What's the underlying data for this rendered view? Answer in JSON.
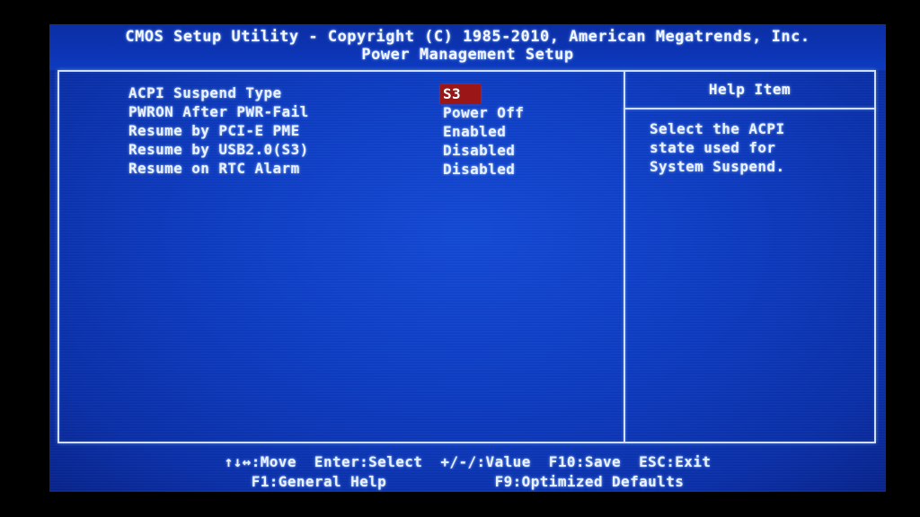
{
  "colors": {
    "screen_blue": "#0d3cc0",
    "header_blue": "#0b2ea4",
    "border": "#cfe0ff",
    "text": "#eaf1ff",
    "highlight_bg": "#9b1717",
    "highlight_text": "#ffffff",
    "bezel": "#000000"
  },
  "header": {
    "title_line_1": "CMOS Setup Utility - Copyright (C) 1985-2010, American Megatrends, Inc.",
    "title_line_2": "Power Management Setup"
  },
  "settings": [
    {
      "label": "ACPI Suspend Type",
      "value": "S3",
      "selected": true
    },
    {
      "label": "PWRON After PWR-Fail",
      "value": "Power Off",
      "selected": false
    },
    {
      "label": "Resume by PCI-E PME",
      "value": "Enabled",
      "selected": false
    },
    {
      "label": "Resume by USB2.0(S3)",
      "value": "Disabled",
      "selected": false
    },
    {
      "label": "Resume on RTC Alarm",
      "value": "Disabled",
      "selected": false
    }
  ],
  "help": {
    "title": "Help Item",
    "lines": [
      "Select the ACPI",
      "state used for",
      "System Suspend."
    ]
  },
  "footer": {
    "line_1": "↑↓↔:Move  Enter:Select  +/-/:Value  F10:Save  ESC:Exit",
    "line_2": "F1:General Help            F9:Optimized Defaults",
    "keys": [
      {
        "key": "↑↓↔",
        "action": "Move"
      },
      {
        "key": "Enter",
        "action": "Select"
      },
      {
        "key": "+/-/",
        "action": "Value"
      },
      {
        "key": "F10",
        "action": "Save"
      },
      {
        "key": "ESC",
        "action": "Exit"
      },
      {
        "key": "F1",
        "action": "General Help"
      },
      {
        "key": "F9",
        "action": "Optimized Defaults"
      }
    ]
  }
}
